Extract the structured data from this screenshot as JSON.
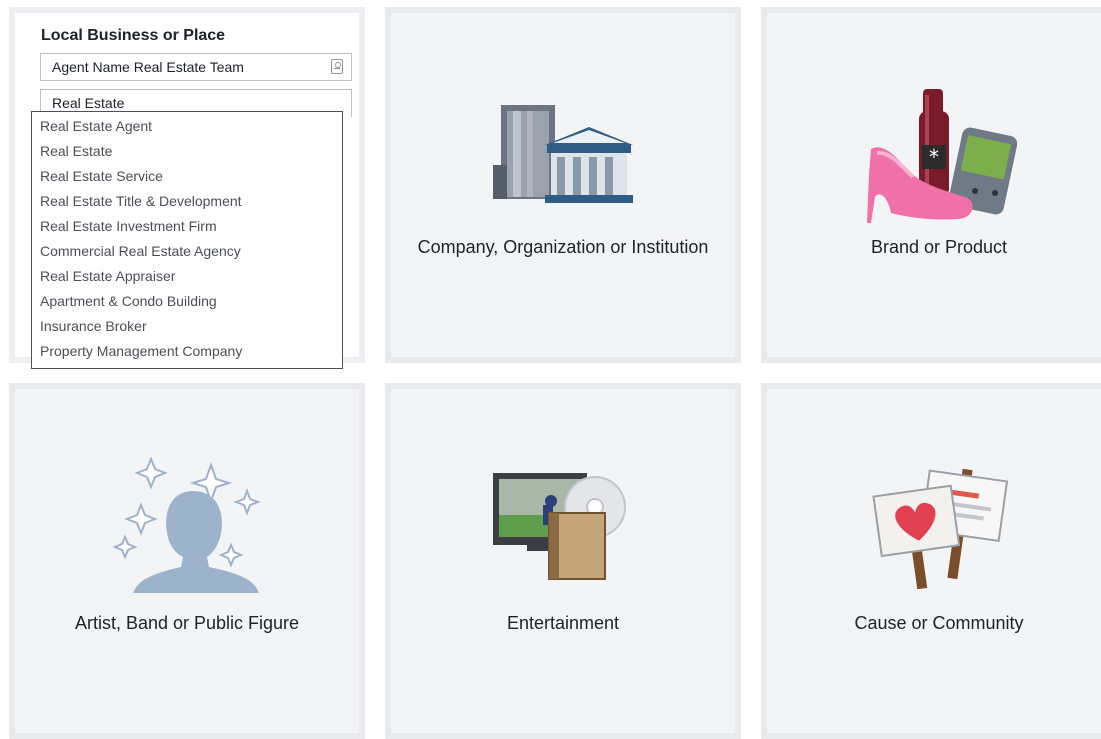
{
  "local_business": {
    "heading": "Local Business or Place",
    "name_value": "Agent Name Real Estate Team",
    "category_value": "Real Estate",
    "options": [
      "Real Estate Agent",
      "Real Estate",
      "Real Estate Service",
      "Real Estate Title & Development",
      "Real Estate Investment Firm",
      "Commercial Real Estate Agency",
      "Real Estate Appraiser",
      "Apartment & Condo Building",
      "Insurance Broker",
      "Property Management Company"
    ]
  },
  "tiles": {
    "company": {
      "label": "Company, Organization or Institution",
      "icon": "buildings-icon"
    },
    "brand": {
      "label": "Brand or Product",
      "icon": "products-icon"
    },
    "artist": {
      "label": "Artist, Band or Public Figure",
      "icon": "person-sparkles-icon"
    },
    "entertainment": {
      "label": "Entertainment",
      "icon": "media-icon"
    },
    "cause": {
      "label": "Cause or Community",
      "icon": "protest-signs-icon"
    }
  },
  "colors": {
    "tile_bg": "#f3f4f6",
    "tile_border": "#e9eaed",
    "text": "#1d2129",
    "option_text": "#4b4f56"
  }
}
